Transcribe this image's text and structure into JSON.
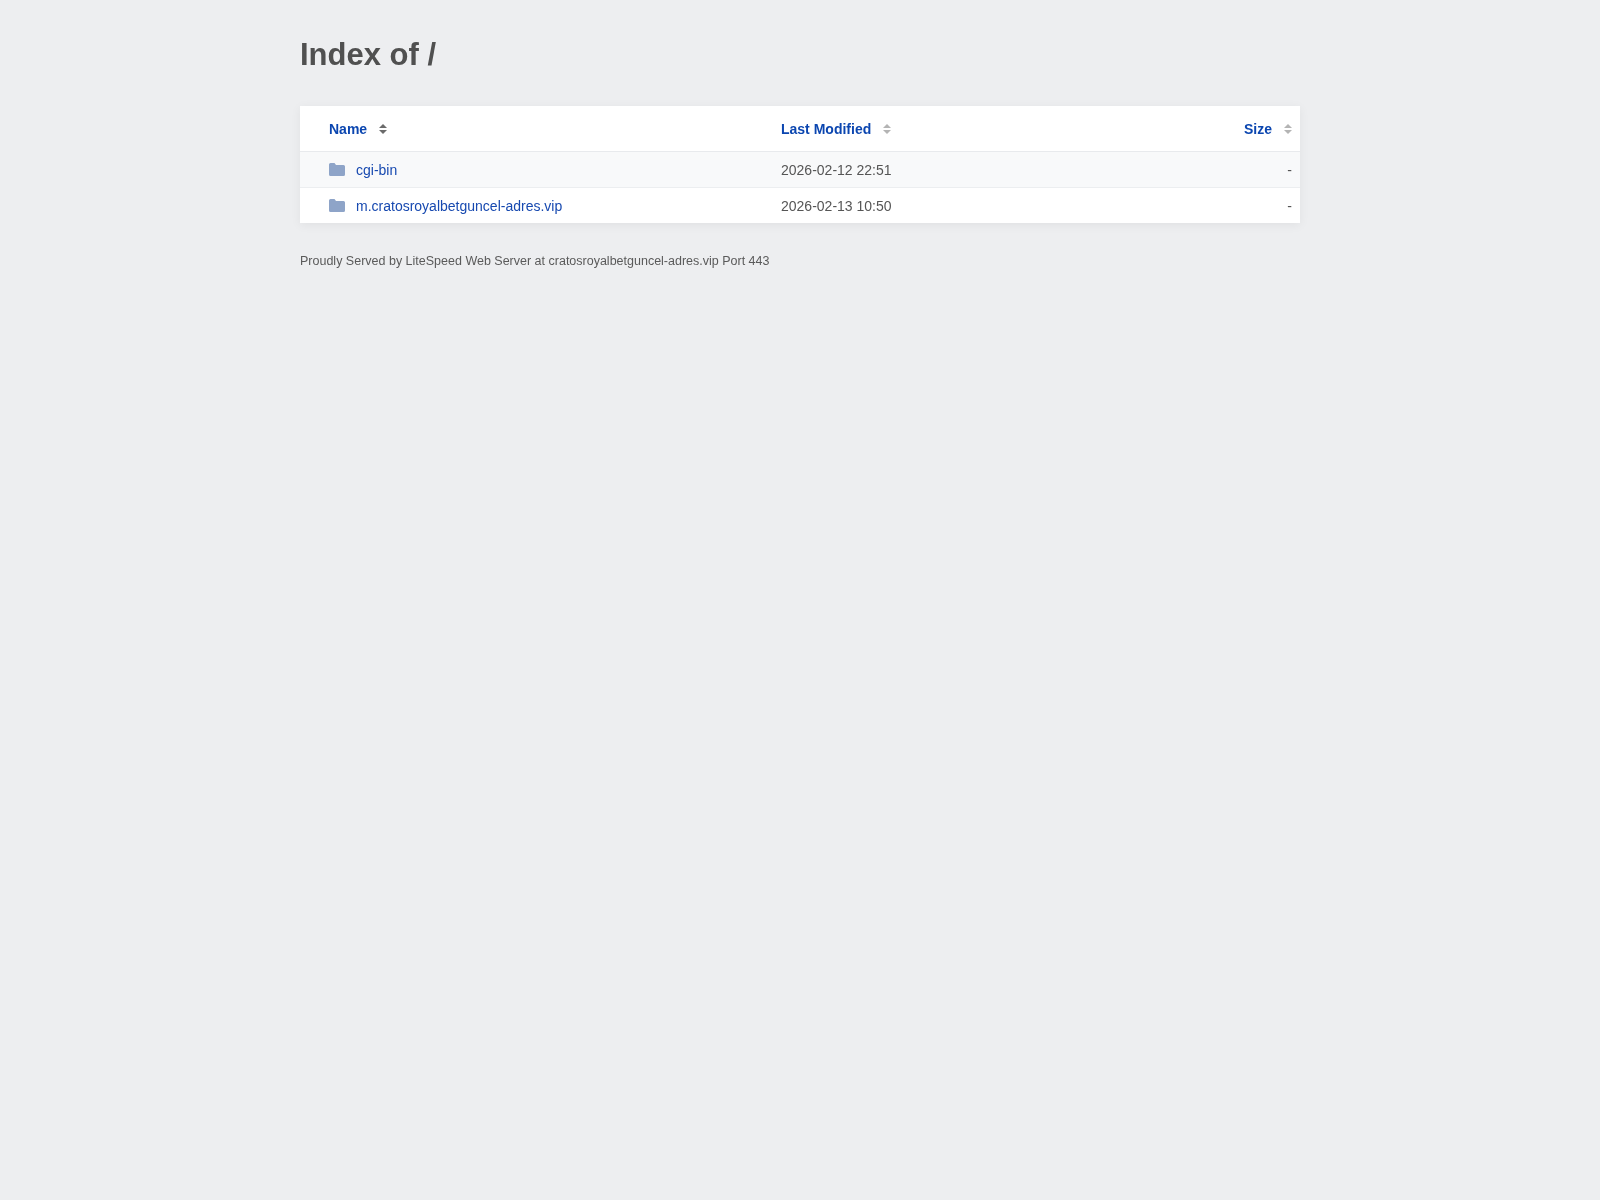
{
  "title": "Index of /",
  "table": {
    "columns": [
      {
        "kind": "name",
        "label": "Name",
        "sorted": true
      },
      {
        "kind": "modified",
        "label": "Last Modified",
        "sorted": false
      },
      {
        "kind": "size",
        "label": "Size",
        "sorted": false
      }
    ],
    "rows": [
      {
        "kind": "folder",
        "name": "cgi-bin",
        "modified": "2026-02-12 22:51",
        "size": "-"
      },
      {
        "kind": "folder",
        "name": "m.cratosroyalbetguncel-adres.vip",
        "modified": "2026-02-13 10:50",
        "size": "-"
      }
    ]
  },
  "footer": "Proudly Served by LiteSpeed Web Server at cratosroyalbetguncel-adres.vip Port 443"
}
